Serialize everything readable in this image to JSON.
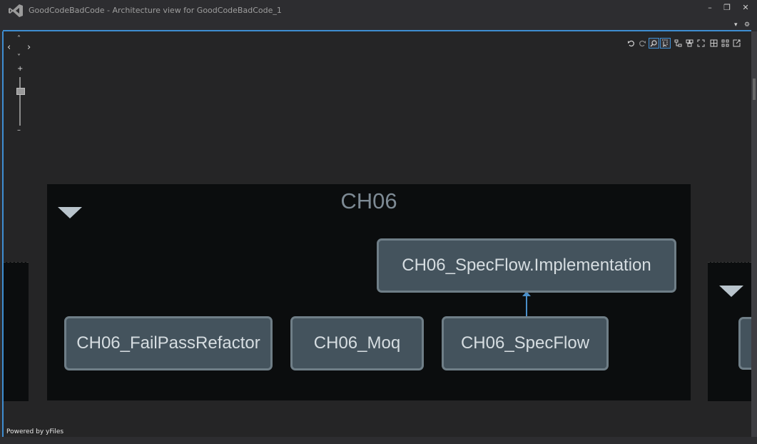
{
  "window": {
    "title": "GoodCodeBadCode - Architecture view for GoodCodeBadCode_1",
    "controls": [
      "–",
      "❐",
      "✕"
    ],
    "tab_menu": [
      "▾",
      "⚙"
    ]
  },
  "navigator": {
    "up": "˄",
    "left": "‹",
    "right": "›",
    "down": "˅",
    "zoom_in": "+",
    "zoom_out": "–",
    "zoom_level": 0.25
  },
  "toolbar": {
    "icons": [
      "undo-icon",
      "redo-icon",
      "zoom-search-icon",
      "select-icon",
      "layout-icon",
      "group-icon",
      "expand-icon",
      "grid-icon",
      "arrange-icon",
      "export-icon"
    ],
    "active": [
      "zoom-search-icon",
      "select-icon"
    ]
  },
  "group": {
    "title": "CH06",
    "nodes": [
      {
        "id": "impl",
        "label": "CH06_SpecFlow.Implementation"
      },
      {
        "id": "failpass",
        "label": "CH06_FailPassRefactor"
      },
      {
        "id": "moq",
        "label": "CH06_Moq"
      },
      {
        "id": "specflow",
        "label": "CH06_SpecFlow"
      }
    ],
    "edges": [
      {
        "from": "specflow",
        "to": "impl"
      }
    ]
  },
  "footer": {
    "powered_by": "Powered by yFiles"
  },
  "colors": {
    "accent": "#3e8dd1",
    "node_fill": "#44535d",
    "node_border": "#6f7e87",
    "group_fill": "#0b0d0e",
    "canvas": "#252526"
  }
}
